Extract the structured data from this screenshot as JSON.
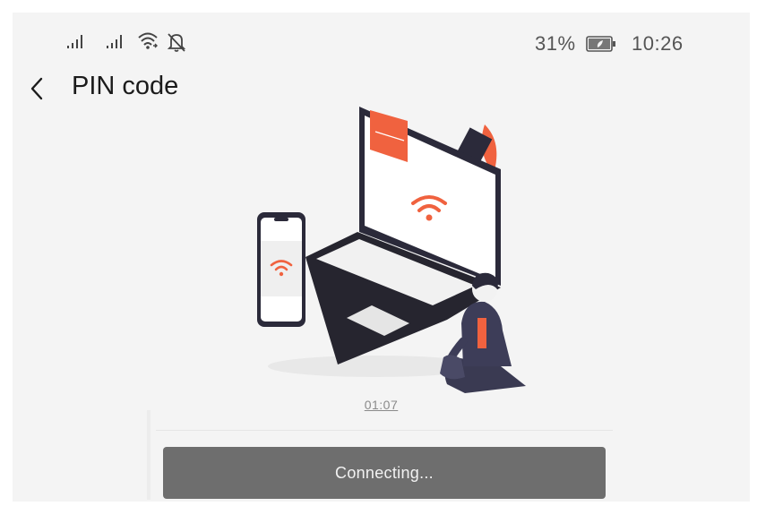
{
  "status_bar": {
    "battery_percent": "31%",
    "time": "10:26",
    "icons": [
      "signal-icon",
      "signal-icon",
      "wifi-icon",
      "bell-off-icon",
      "battery-icon"
    ]
  },
  "header": {
    "back_icon": "chevron-left-icon",
    "title": "PIN code"
  },
  "illustration": {
    "icons": [
      "laptop-illustration",
      "phone-illustration",
      "wifi-icon",
      "person-illustration"
    ],
    "accent_color": "#f0623f"
  },
  "timer": "01:07",
  "action_button": {
    "label": "Connecting..."
  },
  "colors": {
    "button_bg": "#6e6e6e",
    "screen_bg": "#f4f4f4",
    "accent": "#f0623f",
    "dark": "#2b2a3a"
  }
}
